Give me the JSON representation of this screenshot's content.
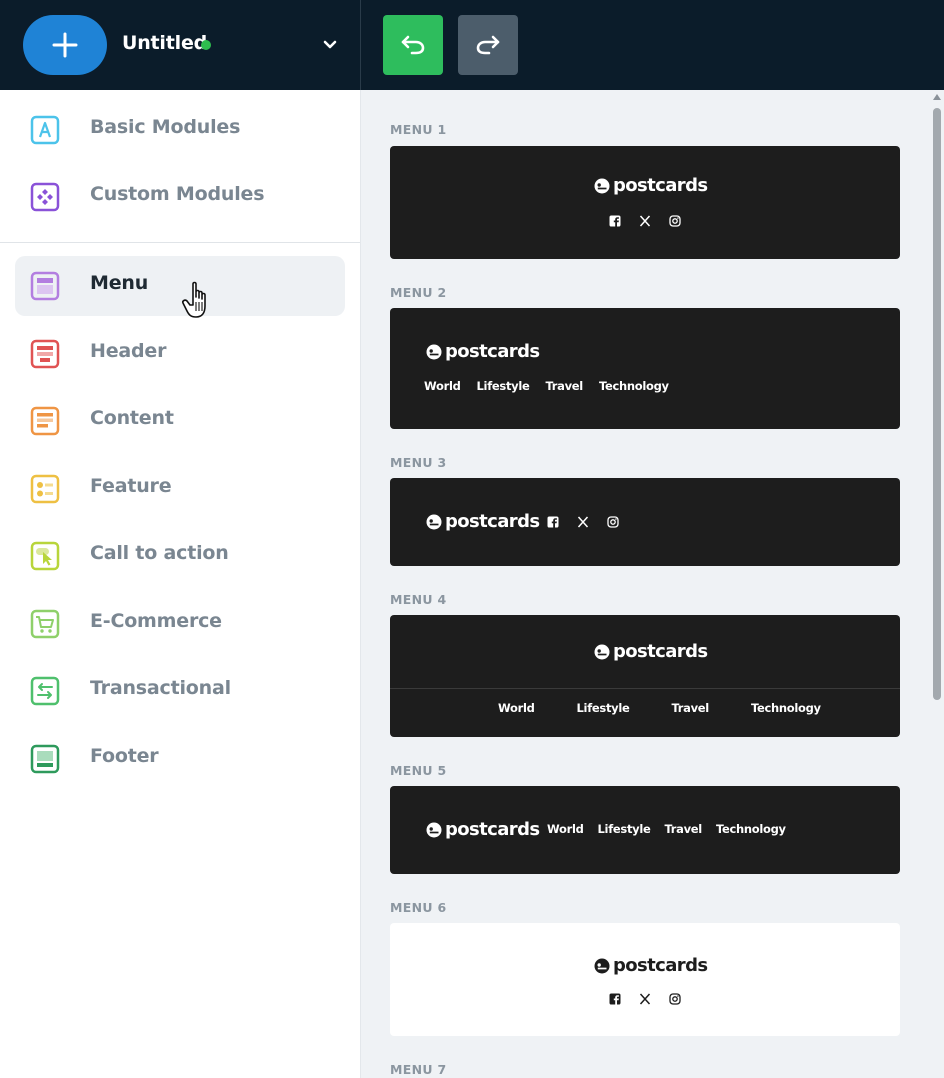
{
  "header": {
    "title": "Untitled",
    "status_color": "#2ebd4e",
    "add_icon": "plus-icon",
    "undo_icon": "undo-icon",
    "redo_icon": "redo-icon"
  },
  "sidebar": {
    "items": [
      {
        "label": "Basic Modules",
        "icon": "basic-modules-icon"
      },
      {
        "label": "Custom Modules",
        "icon": "custom-modules-icon"
      },
      {
        "label": "Menu",
        "icon": "menu-icon",
        "active": true
      },
      {
        "label": "Header",
        "icon": "header-icon"
      },
      {
        "label": "Content",
        "icon": "content-icon"
      },
      {
        "label": "Feature",
        "icon": "feature-icon"
      },
      {
        "label": "Call to action",
        "icon": "call-to-action-icon"
      },
      {
        "label": "E-Commerce",
        "icon": "cart-icon"
      },
      {
        "label": "Transactional",
        "icon": "transactional-icon"
      },
      {
        "label": "Footer",
        "icon": "footer-icon"
      }
    ]
  },
  "main": {
    "brand": "postcards",
    "nav_links": [
      "World",
      "Lifestyle",
      "Travel",
      "Technology"
    ],
    "sections": [
      {
        "label": "MENU 1"
      },
      {
        "label": "MENU 2"
      },
      {
        "label": "MENU 3"
      },
      {
        "label": "MENU 4"
      },
      {
        "label": "MENU 5"
      },
      {
        "label": "MENU 6"
      },
      {
        "label": "MENU 7"
      }
    ]
  }
}
